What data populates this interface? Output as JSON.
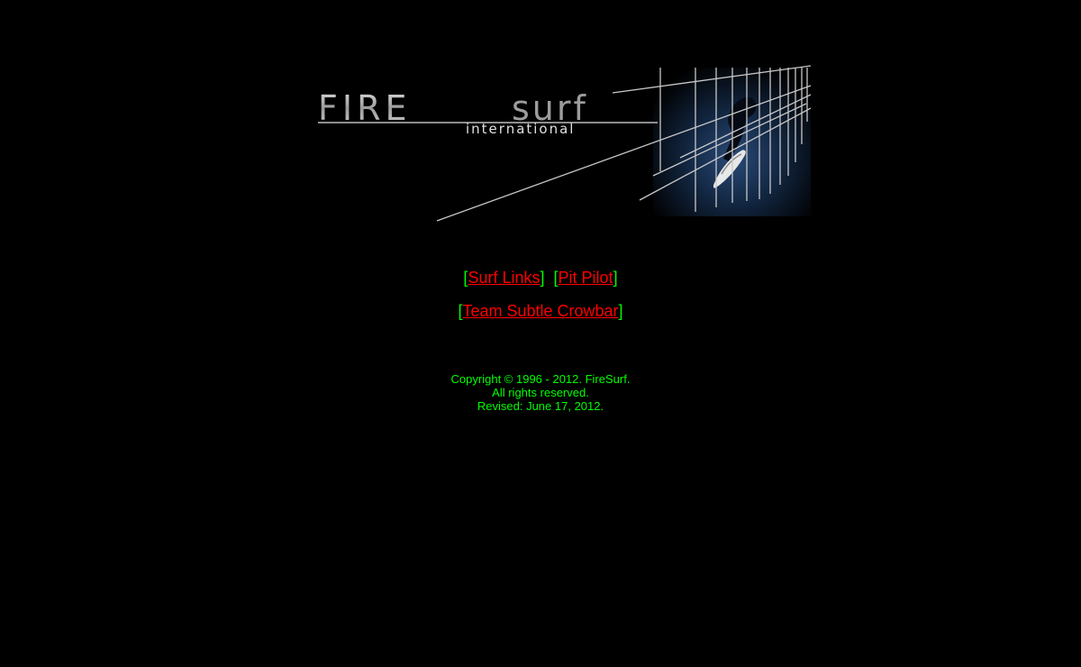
{
  "banner": {
    "logo_fire": "FIRE",
    "logo_surf": "surf",
    "logo_sub": "international"
  },
  "nav": {
    "open": "[",
    "close": "]",
    "links": [
      {
        "label": "Surf Links"
      },
      {
        "label": "Pit Pilot"
      },
      {
        "label": "Team Subtle Crowbar"
      }
    ]
  },
  "footer": {
    "copyright": "Copyright © 1996 - 2012. FireSurf.",
    "rights": "All rights reserved.",
    "revised": "Revised: June 17, 2012."
  },
  "colors": {
    "background": "#000000",
    "link": "#ff0000",
    "bracket": "#00ff00",
    "footer_text": "#00ff00"
  }
}
